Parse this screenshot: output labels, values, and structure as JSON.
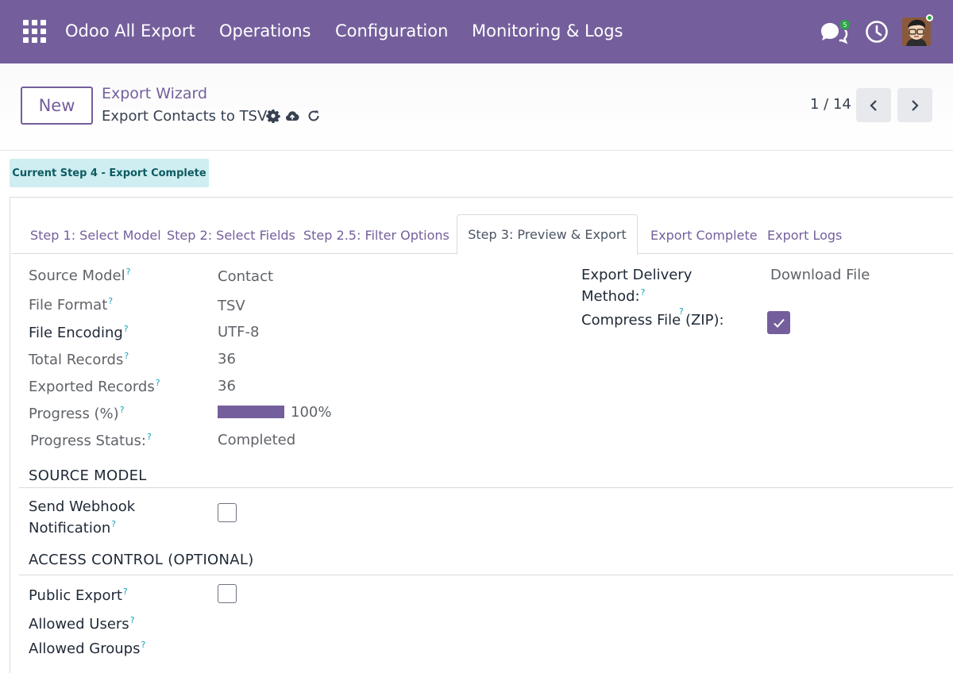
{
  "navbar": {
    "brand": "Odoo All Export",
    "menus": [
      "Operations",
      "Configuration",
      "Monitoring & Logs"
    ],
    "messages_badge": "5"
  },
  "control_panel": {
    "new_label": "New",
    "breadcrumb": "Export Wizard",
    "record_name": "Export Contacts to TSV",
    "pager": "1 / 14"
  },
  "status": "Current Step 4 - Export Complete",
  "tabs": [
    "Step 1: Select Model",
    "Step 2: Select Fields",
    "Step 2.5: Filter Options",
    "Step 3: Preview & Export",
    "Export Complete",
    "Export Logs"
  ],
  "help_mark": "?",
  "fields": {
    "source_model": {
      "label": "Source Model",
      "value": "Contact"
    },
    "file_format": {
      "label": "File Format",
      "value": "TSV"
    },
    "file_encoding": {
      "label": "File Encoding",
      "value": "UTF-8"
    },
    "total_records": {
      "label": "Total Records",
      "value": "36"
    },
    "exported_records": {
      "label": "Exported Records",
      "value": "36"
    },
    "progress": {
      "label": "Progress (%)",
      "value": "100%",
      "fraction": 1.0
    },
    "progress_status": {
      "label": "Progress Status:",
      "value": "Completed"
    },
    "delivery_method": {
      "label_line1": "Export Delivery",
      "label_line2": "Method:",
      "value": "Download File"
    },
    "compress": {
      "label": "Compress File (ZIP):",
      "checked": true
    }
  },
  "section_source": {
    "title": "SOURCE MODEL",
    "webhook_line1": "Send Webhook",
    "webhook_line2": "Notification",
    "webhook_checked": false
  },
  "section_access": {
    "title": "ACCESS CONTROL (OPTIONAL)",
    "public_export": "Public Export",
    "public_checked": false,
    "allowed_users": "Allowed Users",
    "allowed_groups": "Allowed Groups"
  },
  "colors": {
    "brand": "#745f9c",
    "status_bg": "#cfeef1",
    "help": "#17a2b8"
  }
}
